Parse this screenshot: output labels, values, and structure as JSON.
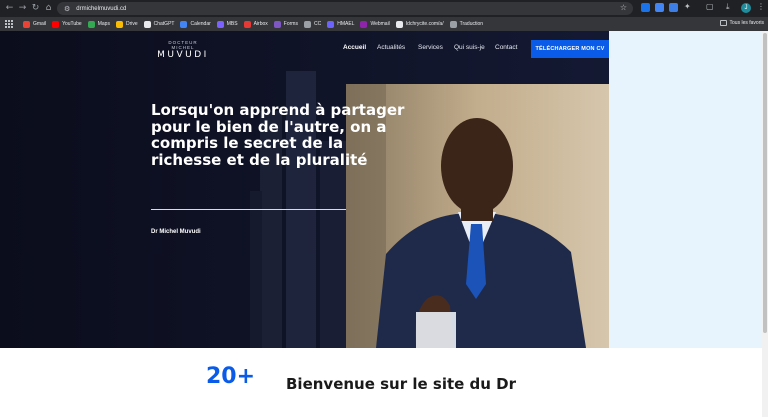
{
  "browser": {
    "url": "drmichelmuvudi.cd",
    "bookmarks": [
      {
        "label": "Gmail",
        "color": "#ea4335"
      },
      {
        "label": "YouTube",
        "color": "#ff0000"
      },
      {
        "label": "Maps",
        "color": "#34a853"
      },
      {
        "label": "Drive",
        "color": "#fbbc04"
      },
      {
        "label": "ChatGPT",
        "color": "#e8eaed"
      },
      {
        "label": "Calendar",
        "color": "#4285f4"
      },
      {
        "label": "MBS",
        "color": "#7b61ff"
      },
      {
        "label": "Airbox",
        "color": "#e53935"
      },
      {
        "label": "Forms",
        "color": "#7e57c2"
      },
      {
        "label": "CC",
        "color": "#9aa0a6"
      },
      {
        "label": "HMAEL",
        "color": "#6c63ff"
      },
      {
        "label": "Webmail",
        "color": "#8e24aa"
      },
      {
        "label": "Idchrycite.com/a/",
        "color": "#e8eaed"
      },
      {
        "label": "Traduction",
        "color": "#9aa0a6"
      }
    ],
    "all_bookmarks_label": "Tous les favoris",
    "profile_initial": "J"
  },
  "site": {
    "logo_small": "DOCTEUR MICHEL",
    "logo_big": "MUVUDI",
    "nav": [
      "Accueil",
      "Actualités",
      "Services",
      "Qui suis-je",
      "Contact"
    ],
    "cta": "TÉLÉCHARGER MON CV",
    "headline": "Lorsqu'on apprend à partager pour le bien de l'autre, on a compris le secret de la richesse et de la pluralité",
    "signature": "Dr Michel Muvudi",
    "stat_number": "20+",
    "welcome": "Bienvenue sur le site du Dr"
  },
  "colors": {
    "accent": "#0a5ce8",
    "hero_bg": "#0b0d1c",
    "side_panel": "#e8f4fd"
  }
}
